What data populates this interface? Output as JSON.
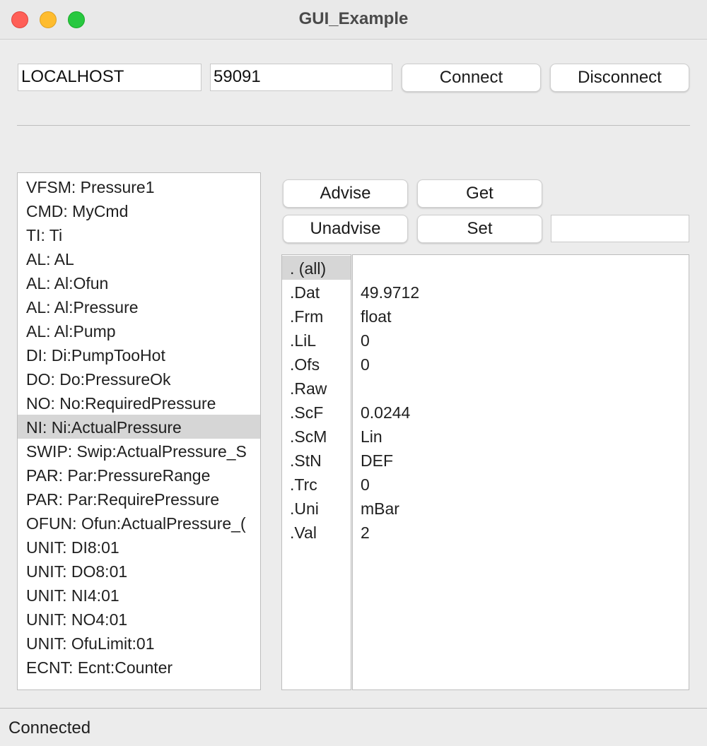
{
  "window": {
    "title": "GUI_Example"
  },
  "connection": {
    "host": "LOCALHOST",
    "port": "59091",
    "connect_label": "Connect",
    "disconnect_label": "Disconnect"
  },
  "actions": {
    "advise_label": "Advise",
    "get_label": "Get",
    "unadvise_label": "Unadvise",
    "set_label": "Set",
    "set_value": ""
  },
  "items": [
    {
      "label": "VFSM: Pressure1"
    },
    {
      "label": "CMD: MyCmd"
    },
    {
      "label": "TI: Ti"
    },
    {
      "label": "AL: AL"
    },
    {
      "label": "AL: Al:Ofun"
    },
    {
      "label": "AL: Al:Pressure"
    },
    {
      "label": "AL: Al:Pump"
    },
    {
      "label": "DI: Di:PumpTooHot"
    },
    {
      "label": "DO: Do:PressureOk"
    },
    {
      "label": "NO: No:RequiredPressure"
    },
    {
      "label": "NI: Ni:ActualPressure",
      "selected": true
    },
    {
      "label": "SWIP: Swip:ActualPressure_S"
    },
    {
      "label": "PAR: Par:PressureRange"
    },
    {
      "label": "PAR: Par:RequirePressure"
    },
    {
      "label": "OFUN: Ofun:ActualPressure_("
    },
    {
      "label": "UNIT: DI8:01"
    },
    {
      "label": "UNIT: DO8:01"
    },
    {
      "label": "UNIT: NI4:01"
    },
    {
      "label": "UNIT: NO4:01"
    },
    {
      "label": "UNIT: OfuLimit:01"
    },
    {
      "label": "ECNT: Ecnt:Counter"
    }
  ],
  "properties": [
    {
      "name": ". (all)",
      "value": "",
      "selected": true
    },
    {
      "name": ".Dat",
      "value": "49.9712"
    },
    {
      "name": ".Frm",
      "value": "float"
    },
    {
      "name": ".LiL",
      "value": "0"
    },
    {
      "name": ".Ofs",
      "value": "0"
    },
    {
      "name": ".Raw",
      "value": ""
    },
    {
      "name": ".ScF",
      "value": "0.0244"
    },
    {
      "name": ".ScM",
      "value": "Lin"
    },
    {
      "name": ".StN",
      "value": "DEF"
    },
    {
      "name": ".Trc",
      "value": "0"
    },
    {
      "name": ".Uni",
      "value": "mBar"
    },
    {
      "name": ".Val",
      "value": "2"
    }
  ],
  "status": {
    "text": "Connected"
  }
}
